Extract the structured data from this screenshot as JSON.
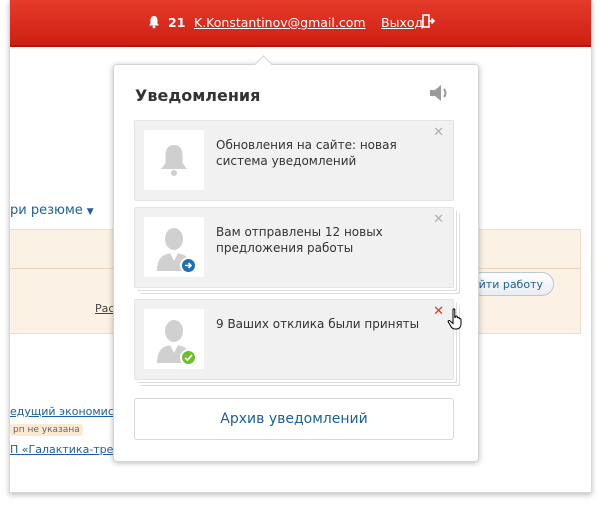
{
  "header": {
    "notification_count": "21",
    "email": "K.Konstantinov@gmail.com",
    "logout_label": "Выход"
  },
  "background": {
    "resume_link": "ри резюме",
    "link_underlined": "Рас",
    "find_job_button": "айти работу",
    "job_title": "едущий экономист",
    "salary_note": "рп не указана",
    "company": "П «Галактика-трейд»"
  },
  "notifications": {
    "title": "Уведомления",
    "items": [
      {
        "text": "Обновления на сайте: новая система уведомлений",
        "icon": "bell-icon"
      },
      {
        "text": "Вам отправлены 12 новых предложения работы",
        "icon": "user-forward-icon"
      },
      {
        "text": "9 Ваших отклика были приняты",
        "icon": "user-check-icon"
      }
    ],
    "archive_label": "Архив уведомлений"
  },
  "colors": {
    "header_red": "#d01f12",
    "link_blue": "#1b5f9e",
    "close_red": "#d33a2c"
  }
}
